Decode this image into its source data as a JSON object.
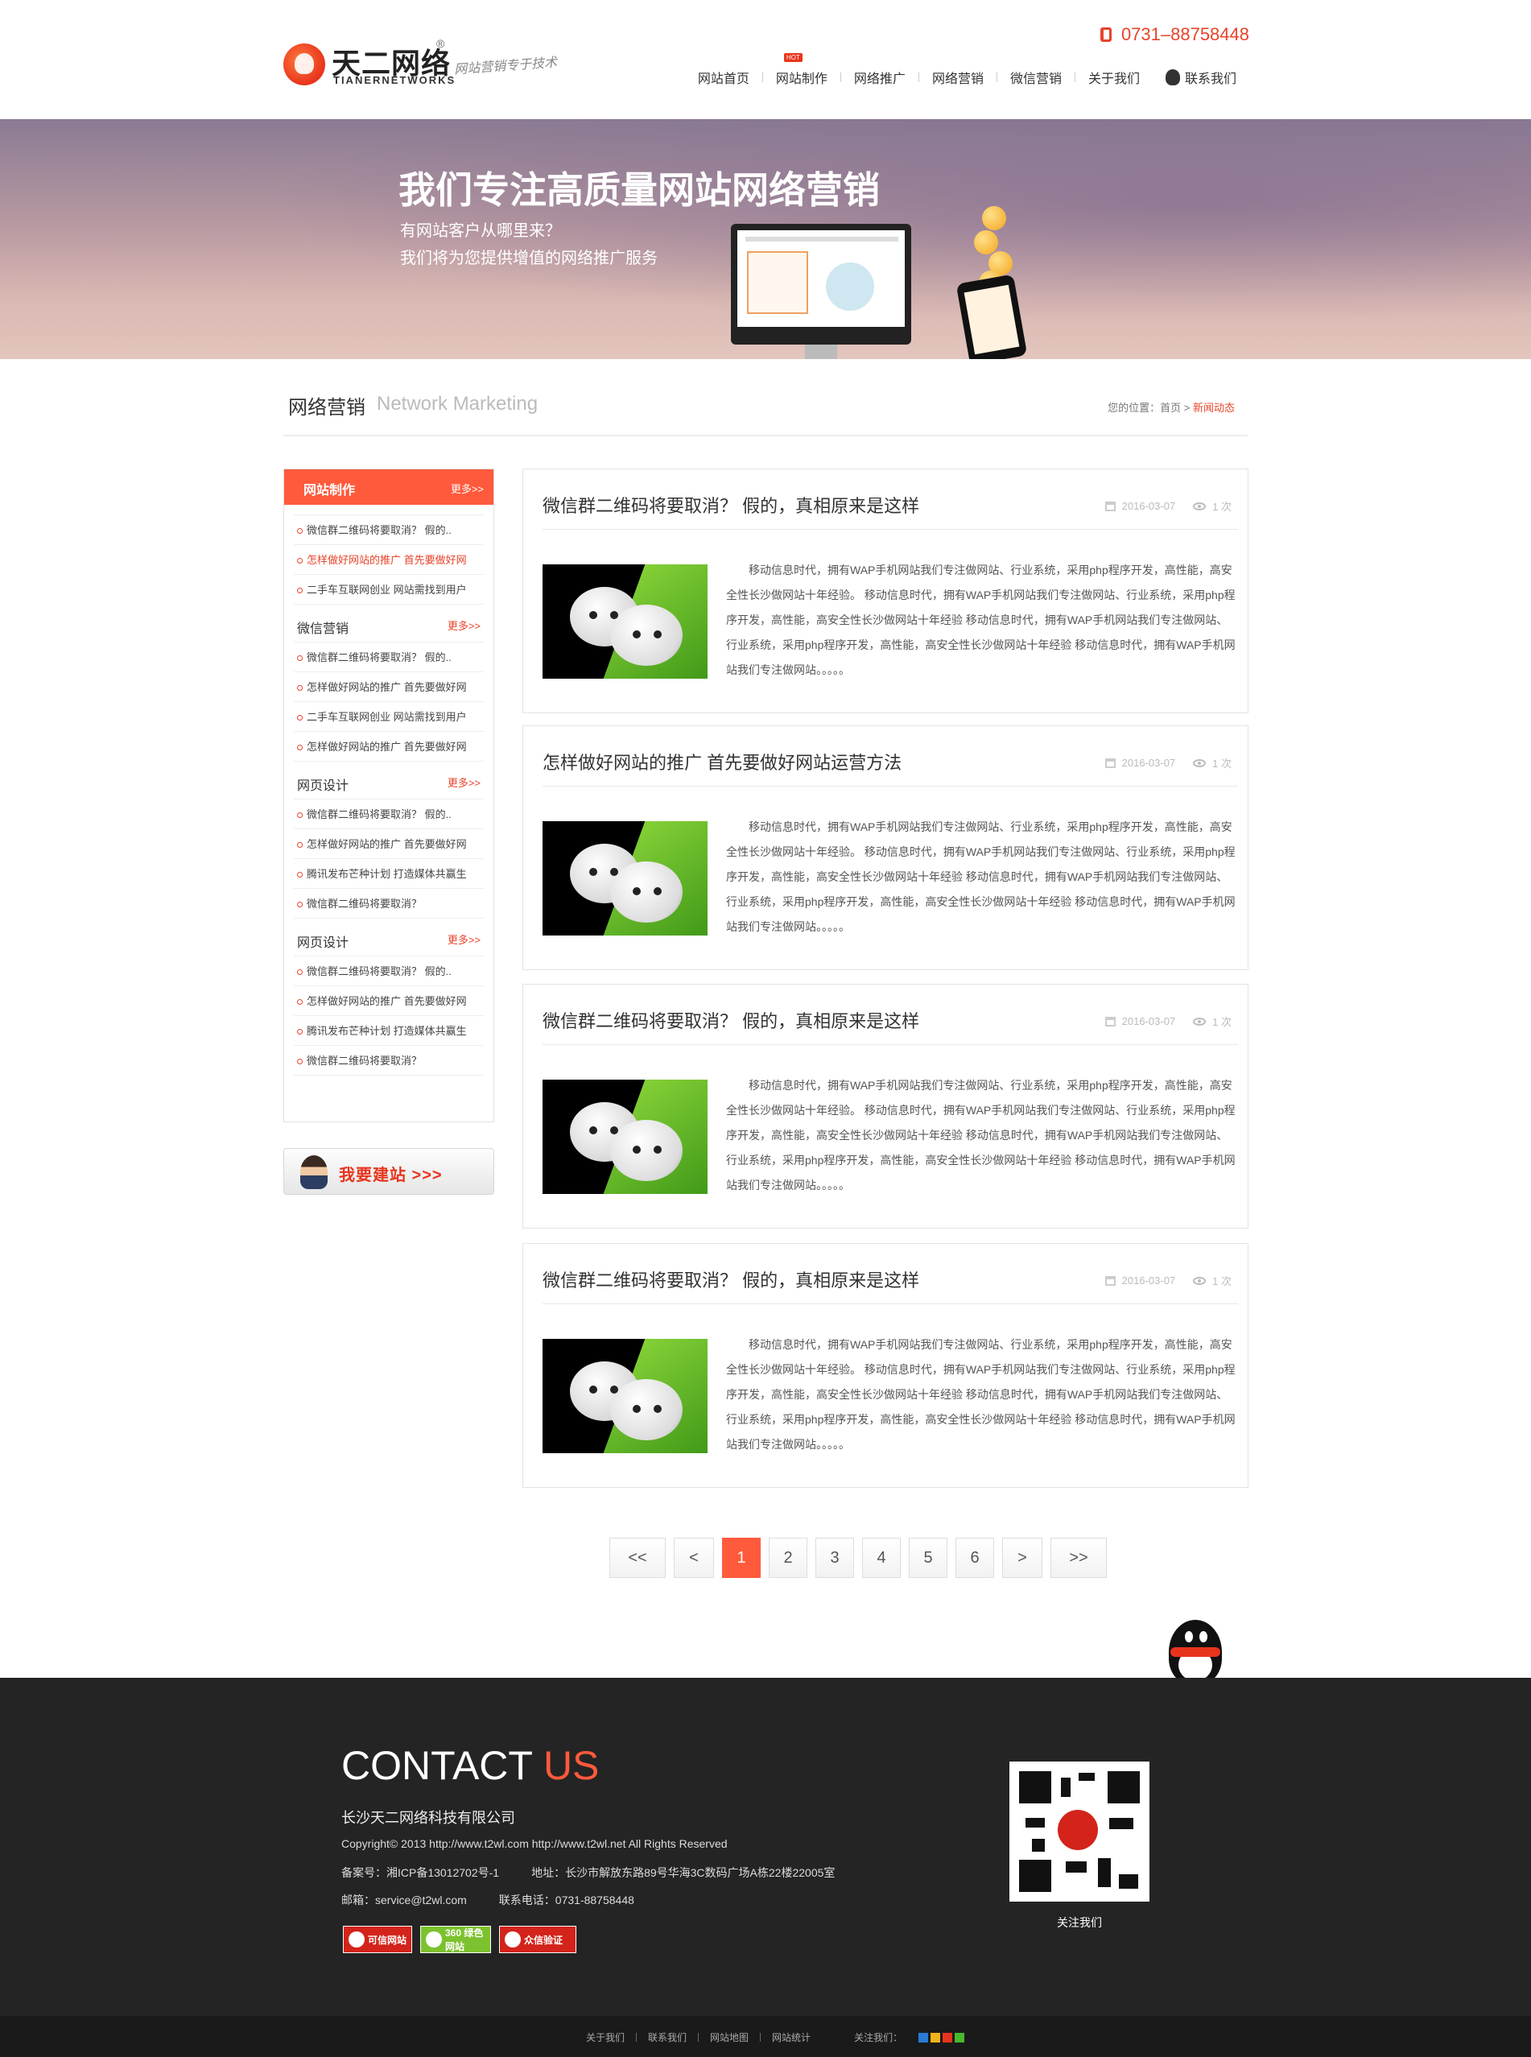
{
  "header": {
    "logo_cn": "天二网络",
    "logo_en": "TIANERNETWORKS",
    "logo_reg": "®",
    "slogan": "网站营销专于技术",
    "hotline": "0731–88758448",
    "hot_badge": "HOT",
    "nav": [
      "网站首页",
      "网站制作",
      "网络推广",
      "网络营销",
      "微信营销",
      "关于我们",
      "联系我们"
    ]
  },
  "banner": {
    "title": "我们专注高质量网站网络营销",
    "line1": "有网站客户从哪里来？",
    "line2": "我们将为您提供增值的网络推广服务"
  },
  "section": {
    "title": "网络营销",
    "title_en": "Network Marketing",
    "crumb_prefix": "您的位置：首页 > ",
    "crumb_active": "新闻动态"
  },
  "sidebar": {
    "head_title": "网站制作",
    "more": "更多>>",
    "head_items": [
      "微信群二维码将要取消？ 假的..",
      "怎样做好网站的推广 首先要做好网",
      "二手车互联网创业 网站需找到用户"
    ],
    "groups": [
      {
        "title": "微信营销",
        "items": [
          "微信群二维码将要取消？ 假的..",
          "怎样做好网站的推广 首先要做好网",
          "二手车互联网创业 网站需找到用户",
          "怎样做好网站的推广 首先要做好网"
        ]
      },
      {
        "title": "网页设计",
        "items": [
          "微信群二维码将要取消？ 假的..",
          "怎样做好网站的推广 首先要做好网",
          "腾讯发布芒种计划 打造媒体共赢生",
          "微信群二维码将要取消？"
        ]
      },
      {
        "title": "网页设计",
        "items": [
          "微信群二维码将要取消？ 假的..",
          "怎样做好网站的推广 首先要做好网",
          "腾讯发布芒种计划 打造媒体共赢生",
          "微信群二维码将要取消？"
        ]
      }
    ],
    "build_label": "我要建站 >>>"
  },
  "articles": [
    {
      "title": "微信群二维码将要取消？ 假的，真相原来是这样",
      "date": "2016-03-07",
      "views": "1 次",
      "body": "移动信息时代，拥有WAP手机网站我们专注做网站、行业系统，采用php程序开发，高性能，高安全性长沙做网站十年经验。     移动信息时代，拥有WAP手机网站我们专注做网站、行业系统，采用php程序开发，高性能，高安全性长沙做网站十年经验     移动信息时代，拥有WAP手机网站我们专注做网站、行业系统，采用php程序开发，高性能，高安全性长沙做网站十年经验     移动信息时代，拥有WAP手机网站我们专注做网站。。。。。"
    },
    {
      "title": "怎样做好网站的推广 首先要做好网站运营方法",
      "date": "2016-03-07",
      "views": "1 次",
      "body": "移动信息时代，拥有WAP手机网站我们专注做网站、行业系统，采用php程序开发，高性能，高安全性长沙做网站十年经验。     移动信息时代，拥有WAP手机网站我们专注做网站、行业系统，采用php程序开发，高性能，高安全性长沙做网站十年经验     移动信息时代，拥有WAP手机网站我们专注做网站、行业系统，采用php程序开发，高性能，高安全性长沙做网站十年经验     移动信息时代，拥有WAP手机网站我们专注做网站。。。。。"
    },
    {
      "title": "微信群二维码将要取消？ 假的，真相原来是这样",
      "date": "2016-03-07",
      "views": "1 次",
      "body": "移动信息时代，拥有WAP手机网站我们专注做网站、行业系统，采用php程序开发，高性能，高安全性长沙做网站十年经验。     移动信息时代，拥有WAP手机网站我们专注做网站、行业系统，采用php程序开发，高性能，高安全性长沙做网站十年经验     移动信息时代，拥有WAP手机网站我们专注做网站、行业系统，采用php程序开发，高性能，高安全性长沙做网站十年经验     移动信息时代，拥有WAP手机网站我们专注做网站。。。。。"
    },
    {
      "title": "微信群二维码将要取消？ 假的，真相原来是这样",
      "date": "2016-03-07",
      "views": "1 次",
      "body": "移动信息时代，拥有WAP手机网站我们专注做网站、行业系统，采用php程序开发，高性能，高安全性长沙做网站十年经验。     移动信息时代，拥有WAP手机网站我们专注做网站、行业系统，采用php程序开发，高性能，高安全性长沙做网站十年经验     移动信息时代，拥有WAP手机网站我们专注做网站、行业系统，采用php程序开发，高性能，高安全性长沙做网站十年经验     移动信息时代，拥有WAP手机网站我们专注做网站。。。。。"
    }
  ],
  "pager": {
    "first": "<<",
    "prev": "<",
    "pages": [
      "1",
      "2",
      "3",
      "4",
      "5",
      "6"
    ],
    "current": "1",
    "next": ">",
    "last": ">>"
  },
  "footer": {
    "contact": "CONTACT",
    "contact_us": "US",
    "company": "长沙天二网络科技有限公司",
    "copyright": "Copyright© 2013 http://www.t2wl.com http://www.t2wl.net All Rights Reserved",
    "icp": "备案号：湘ICP备13012702号-1",
    "address": "地址：长沙市解放东路89号华海3C数码广场A栋22楼22005室",
    "email": "邮箱：service@t2wl.com",
    "phone": "联系电话：0731-88758448",
    "badges": [
      "可信网站",
      "360 绿色网站",
      "众信验证"
    ],
    "qr_caption": "关注我们",
    "bottom_links": [
      "关于我们",
      "联系我们",
      "网站地图",
      "网站统计"
    ],
    "share_label": "关注我们："
  }
}
